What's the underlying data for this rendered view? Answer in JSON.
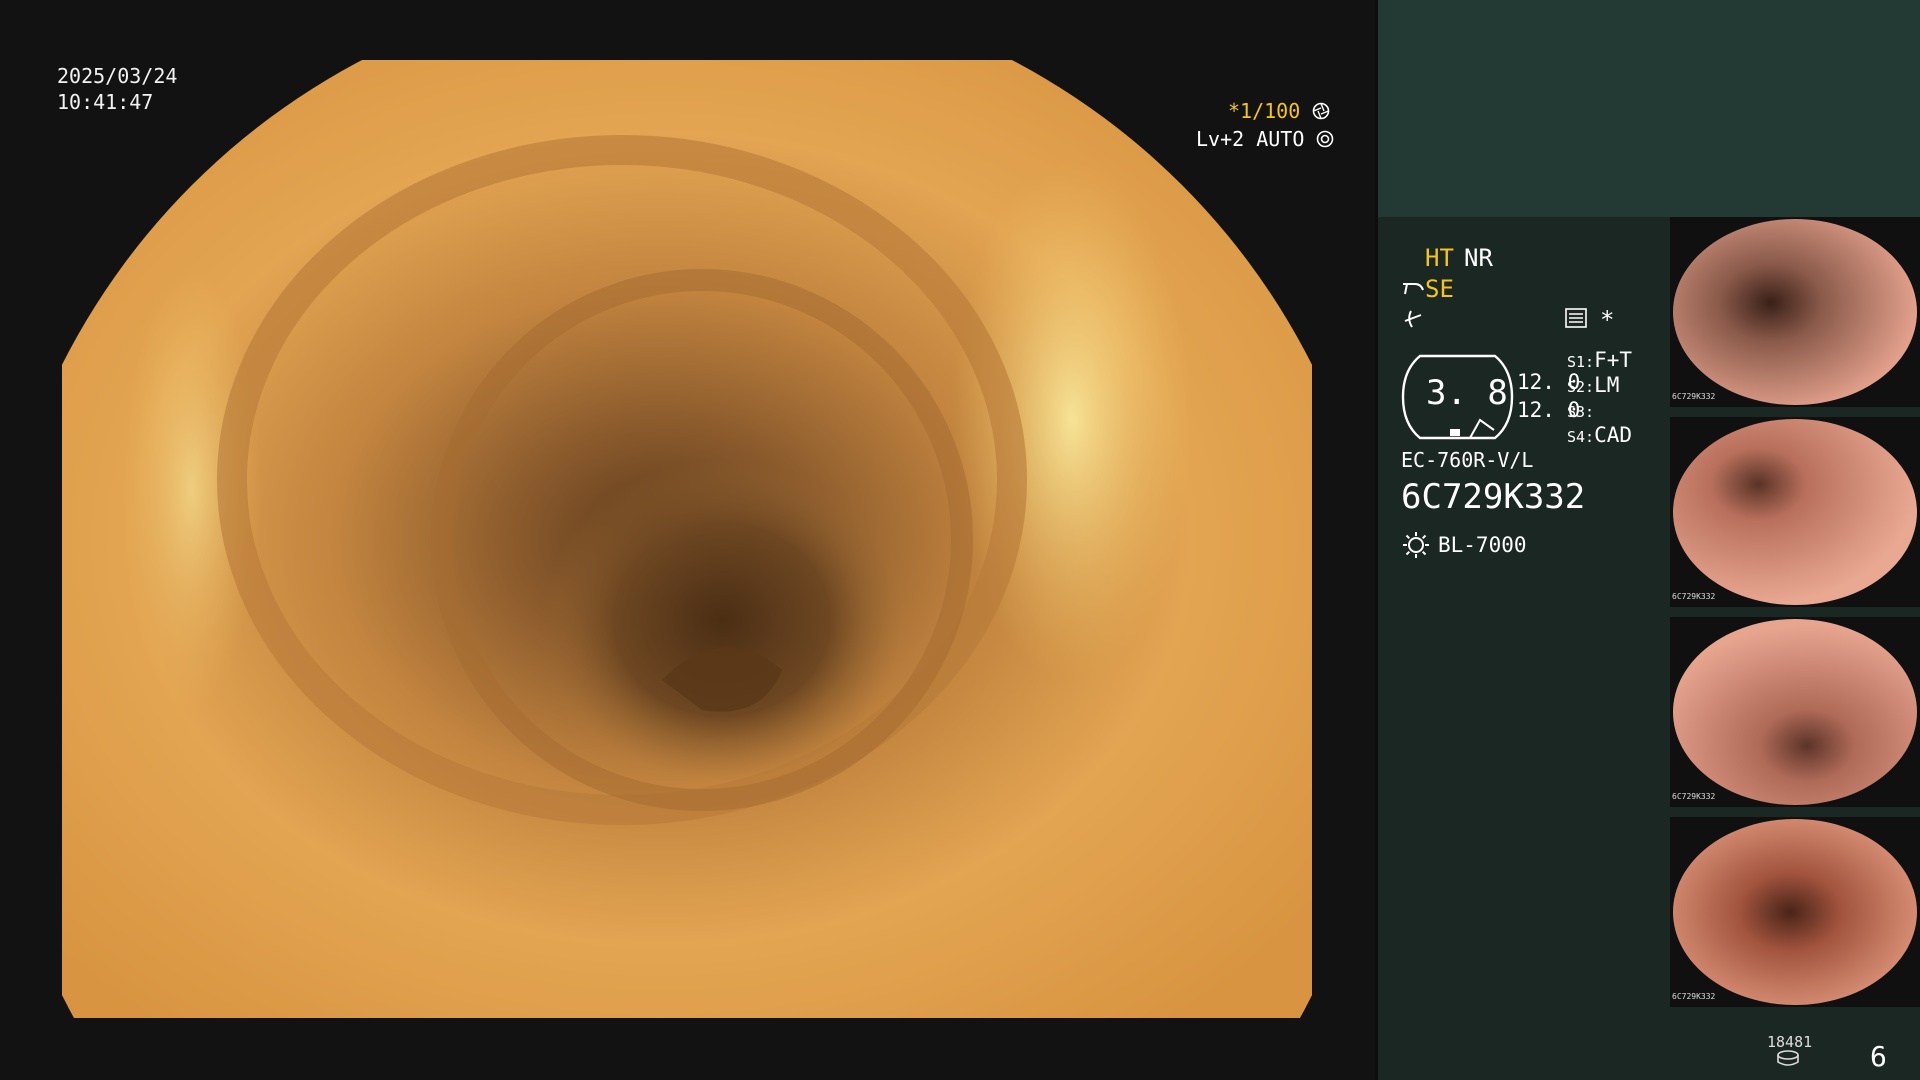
{
  "overlay": {
    "date": "2025/03/24",
    "time": "10:41:47",
    "shutter_prefix": "*",
    "shutter_value": "1/100",
    "gain": "Lv+2",
    "auto_label": "AUTO"
  },
  "settings": {
    "ht": "HT",
    "nr": "NR",
    "se": "SE",
    "zoom_value": "3. 8",
    "values": [
      "12. 0",
      "12. 0"
    ],
    "s1_label": "S1:",
    "s1_value": "F+T",
    "s2_label": "S2:",
    "s2_value": "LM",
    "s3_label": "S3:",
    "s3_value": "",
    "s4_label": "S4:",
    "s4_value": "CAD",
    "star": "*"
  },
  "device": {
    "scope_model": "EC-760R-V/L",
    "serial": "6C729K332",
    "light_source": "BL-7000"
  },
  "thumbnails": [
    {
      "label": "6C729K332"
    },
    {
      "label": "6C729K332"
    },
    {
      "label": "6C729K332"
    },
    {
      "label": "6C729K332"
    }
  ],
  "footer": {
    "storage_count": "18481",
    "image_count": "6"
  },
  "colors": {
    "accent_yellow": "#f5c518",
    "panel_dark": "#1b2723",
    "panel_top": "#223934"
  },
  "icons": [
    "aperture-icon",
    "target-icon",
    "scope-tip-icon",
    "filter-icon",
    "settings-list-icon",
    "sun-icon",
    "disk-icon"
  ]
}
